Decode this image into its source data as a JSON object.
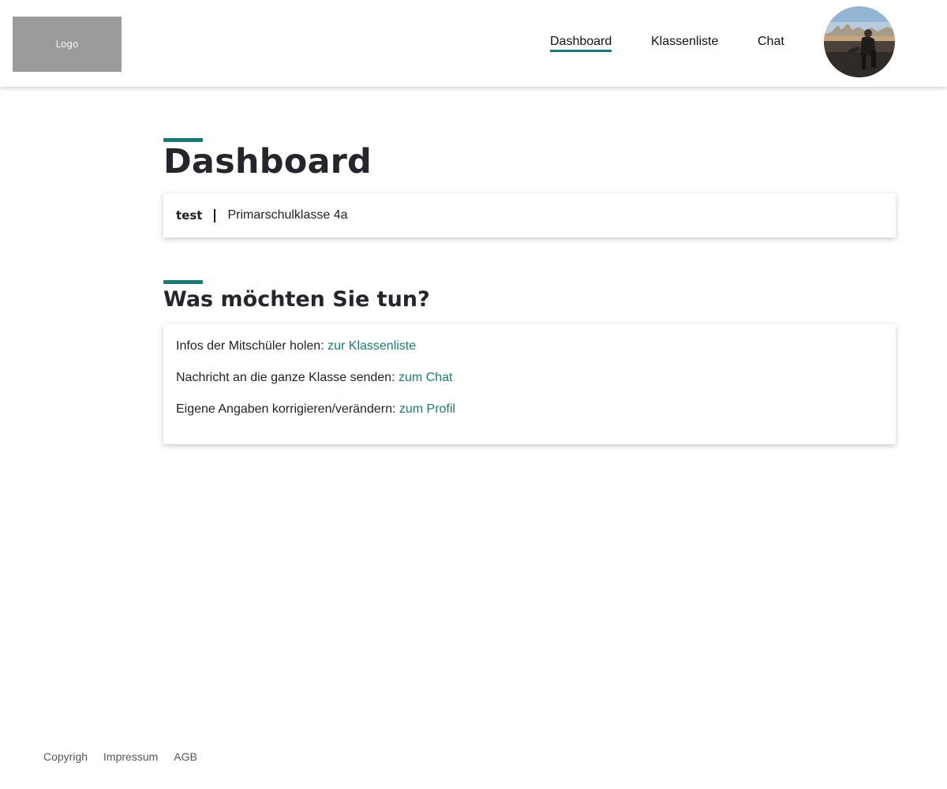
{
  "header": {
    "logo_text": "Logo",
    "nav": [
      {
        "label": "Dashboard",
        "active": true
      },
      {
        "label": "Klassenliste",
        "active": false
      },
      {
        "label": "Chat",
        "active": false
      }
    ],
    "avatar_icon": "user-avatar-photo"
  },
  "colors": {
    "accent": "#1a7a73",
    "title": "#24262b",
    "logo_bg": "#9b9b9b"
  },
  "main": {
    "title": "Dashboard",
    "class_card": {
      "user": "test",
      "class_name": "Primarschulklasse 4a"
    },
    "actions_title": "Was möchten Sie tun?",
    "actions": [
      {
        "text": "Infos der Mitschüler holen: ",
        "link": "zur Klassenliste"
      },
      {
        "text": "Nachricht an die ganze Klasse senden: ",
        "link": "zum Chat"
      },
      {
        "text": "Eigene Angaben korrigieren/verändern: ",
        "link": "zum Profil"
      }
    ]
  },
  "footer": {
    "links": [
      "Copyrigh",
      "Impressum",
      "AGB"
    ]
  }
}
